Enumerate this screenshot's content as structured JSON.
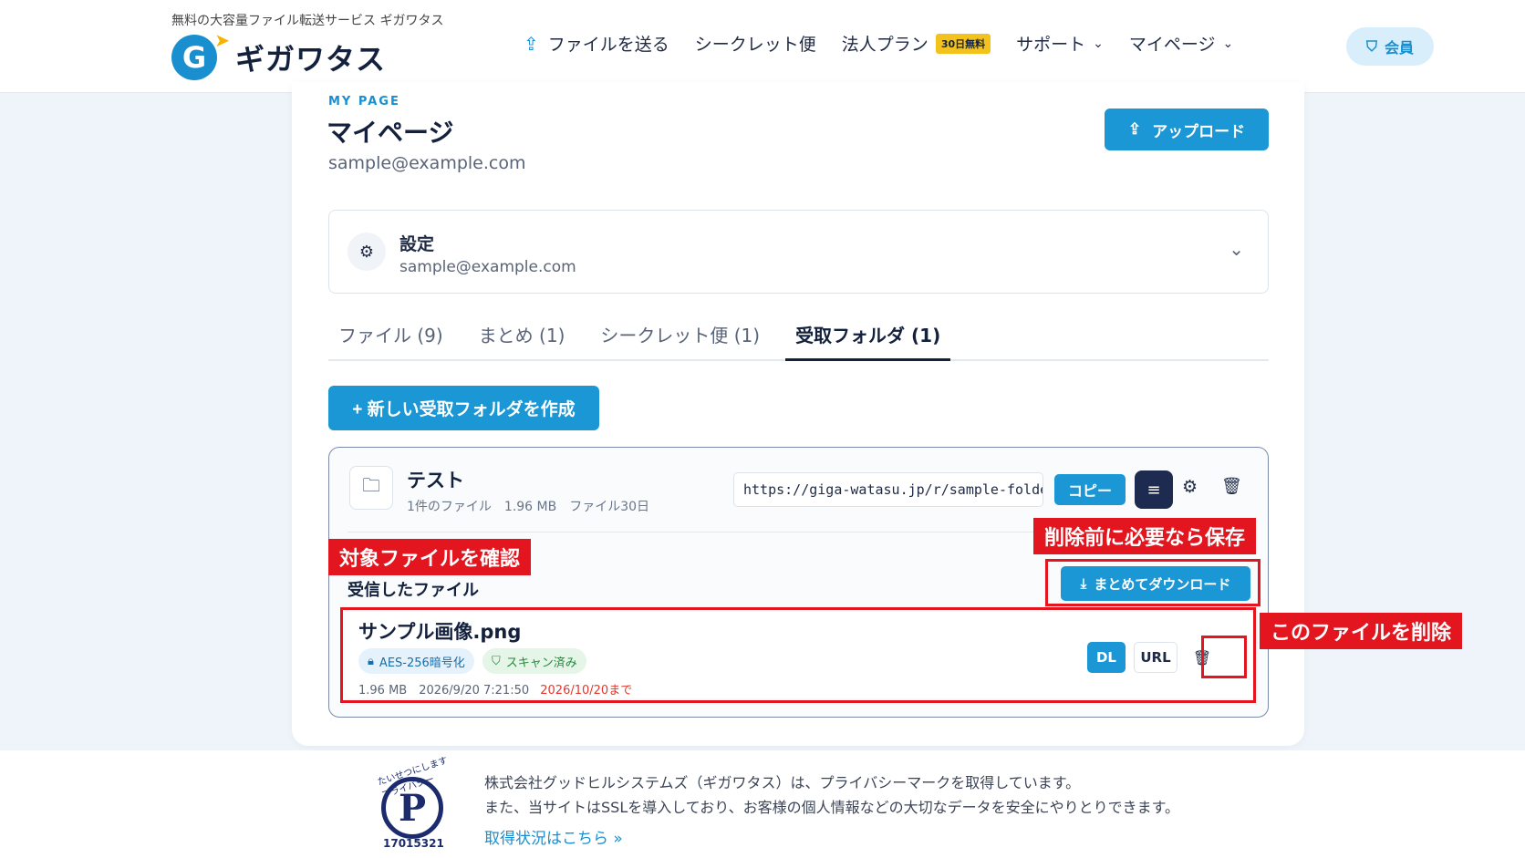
{
  "header": {
    "tagline": "無料の大容量ファイル転送サービス ギガワタス",
    "logo_text": "ギガワタス",
    "logo_letter": "G",
    "nav": [
      {
        "label": "ファイルを送る",
        "icon": "cloud-upload-icon"
      },
      {
        "label": "シークレット便"
      },
      {
        "label": "法人プラン",
        "badge": "30日無料"
      },
      {
        "label": "サポート",
        "icon": "chevron-down-icon"
      },
      {
        "label": "マイページ",
        "icon": "chevron-down-icon"
      }
    ],
    "member_label": "会員",
    "member_icon": "shield-icon"
  },
  "page": {
    "label": "MY PAGE",
    "title": "マイページ",
    "email": "sample@example.com",
    "upload_label": "アップロード"
  },
  "settings": {
    "title": "設定",
    "email": "sample@example.com"
  },
  "tabs": [
    {
      "label": "ファイル (9)",
      "active": false
    },
    {
      "label": "まとめ (1)",
      "active": false
    },
    {
      "label": "シークレット便 (1)",
      "active": false
    },
    {
      "label": "受取フォルダ (1)",
      "active": true
    }
  ],
  "new_folder_label": "+ 新しい受取フォルダを作成",
  "folder": {
    "name": "テスト",
    "meta": "1件のファイル　1.96 MB　ファイル30日",
    "url": "https://giga-watasu.jp/r/sample-folder",
    "copy_label": "コピー",
    "received_label": "受信したファイル",
    "download_all_label": "まとめてダウンロード",
    "file": {
      "name": "サンプル画像.png",
      "chip_aes": "AES-256暗号化",
      "chip_scan": "スキャン済み",
      "meta": "1.96 MB　2026/9/20 7:21:50",
      "expiry": "2026/10/20まで",
      "dl_label": "DL",
      "url_label": "URL"
    }
  },
  "annotations": {
    "check_file": "対象ファイルを確認",
    "save_before_delete": "削除前に必要なら保存",
    "delete_this_file": "このファイルを削除",
    "color": "#e3161f"
  },
  "footer": {
    "line1": "株式会社グッドヒルシステムズ（ギガワタス）は、プライバシーマークを取得しています。",
    "line2": "また、当サイトはSSLを導入しており、お客様の個人情報などの大切なデータを安全にやりとりできます。",
    "link": "取得状況はこちら »",
    "pmark_number": "17015321",
    "pmark_arc": "たいせつにします プライバシー"
  },
  "colors": {
    "accent": "#1a97d4",
    "navy": "#14213d",
    "alert": "#e3161f"
  }
}
